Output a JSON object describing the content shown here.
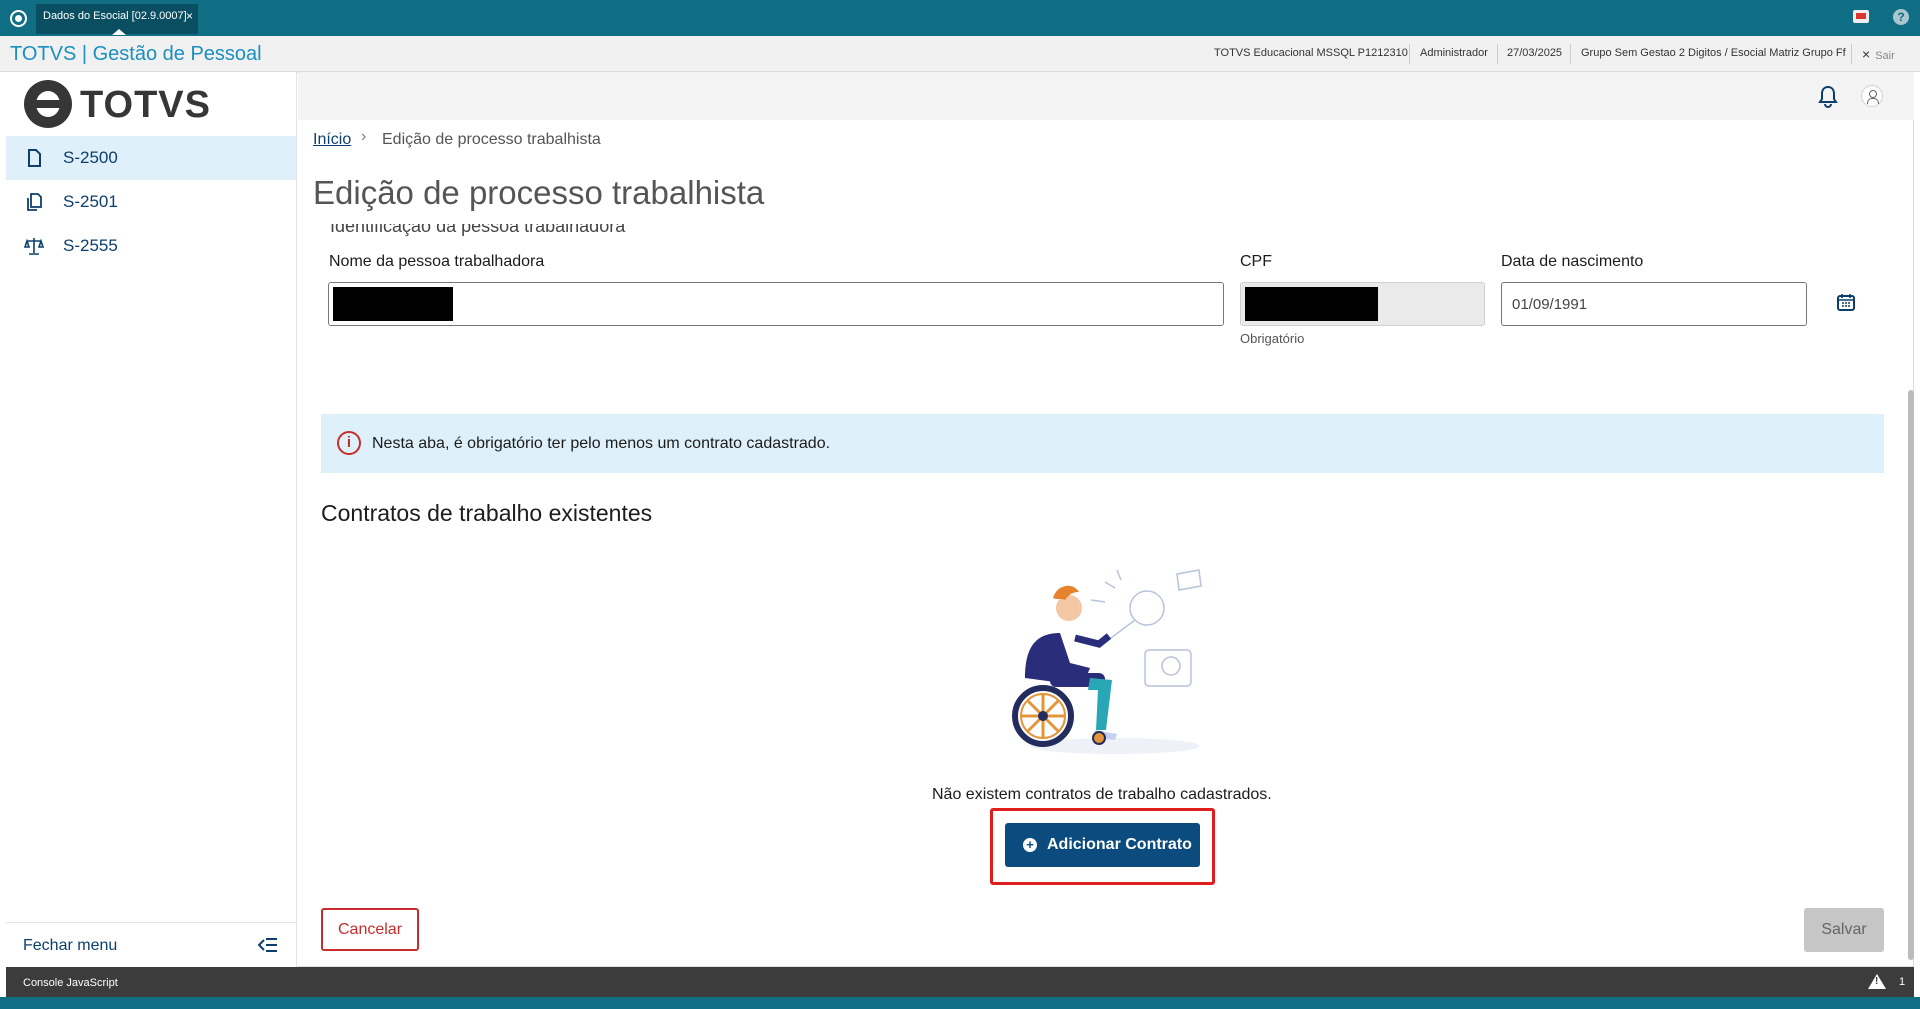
{
  "window": {
    "tab_title": "Dados do Esocial [02.9.0007]",
    "tab_close": "×"
  },
  "header": {
    "brand": "TOTVS | Gestão de Pessoal",
    "environment": "TOTVS Educacional MSSQL P1212310",
    "user": "Administrador",
    "date": "27/03/2025",
    "company": "Grupo Sem Gestao 2 Digitos / Esocial Matriz Grupo Ff",
    "exit_label": "Sair",
    "exit_icon": "×"
  },
  "sidebar": {
    "logo_text": "TOTVS",
    "items": [
      {
        "label": "S-2500",
        "icon": "file-icon",
        "active": true
      },
      {
        "label": "S-2501",
        "icon": "copy-icon",
        "active": false
      },
      {
        "label": "S-2555",
        "icon": "scale-icon",
        "active": false
      }
    ],
    "close_menu_label": "Fechar menu"
  },
  "breadcrumb": {
    "home": "Início",
    "separator": "›",
    "current": "Edição de processo trabalhista"
  },
  "page": {
    "title": "Edição de processo trabalhista",
    "clipped_section": "Identificação da pessoa trabalhadora"
  },
  "form": {
    "name_label": "Nome da pessoa trabalhadora",
    "cpf_label": "CPF",
    "cpf_helper": "Obrigatório",
    "birth_label": "Data de nascimento",
    "birth_value": "01/09/1991"
  },
  "alert": {
    "icon": "i",
    "text": "Nesta aba, é obrigatório ter pelo menos um contrato cadastrado."
  },
  "contracts": {
    "section_title": "Contratos de trabalho existentes",
    "empty_text": "Não existem contratos de trabalho cadastrados.",
    "add_button": "Adicionar Contrato",
    "add_icon": "+"
  },
  "actions": {
    "cancel": "Cancelar",
    "save": "Salvar"
  },
  "console": {
    "label": "Console JavaScript",
    "warning_count": "1"
  },
  "colors": {
    "titlebar": "#0f6e84",
    "primary": "#0b4b7e",
    "danger": "#c72d2d",
    "alert_bg": "#def0fa",
    "brand": "#1a8fc0"
  }
}
